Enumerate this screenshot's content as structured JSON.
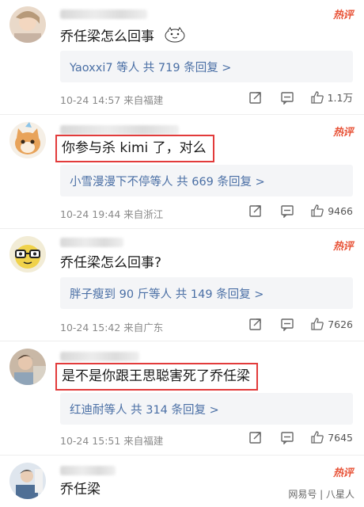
{
  "hot_label": "热评",
  "comments": [
    {
      "content": "乔任梁怎么回事",
      "reply": "Yaoxxi7 等人  共 719 条回复 >",
      "meta": "10-24 14:57  来自福建",
      "likes": "1.1万"
    },
    {
      "content": "你参与杀 kimi 了，对么",
      "reply": "小雪漫漫下不停等人  共 669 条回复 >",
      "meta": "10-24 19:44  来自浙江",
      "likes": "9466"
    },
    {
      "content": "乔任梁怎么回事?",
      "reply": "胖子瘦到 90 斤等人  共 149 条回复 >",
      "meta": "10-24 15:42  来自广东",
      "likes": "7626"
    },
    {
      "content": "是不是你跟王思聪害死了乔任梁",
      "reply": "红迪耐等人  共 314 条回复 >",
      "meta": "10-24 15:51  来自福建",
      "likes": "7645"
    },
    {
      "content": "乔任梁"
    }
  ],
  "watermark": "网易号 | 八星人",
  "icons": [
    "share-icon",
    "comment-icon",
    "like-icon"
  ],
  "colors": {
    "hot": "#e8553a",
    "reply_link": "#4a6fa5",
    "highlight_box": "#e23b3b"
  }
}
